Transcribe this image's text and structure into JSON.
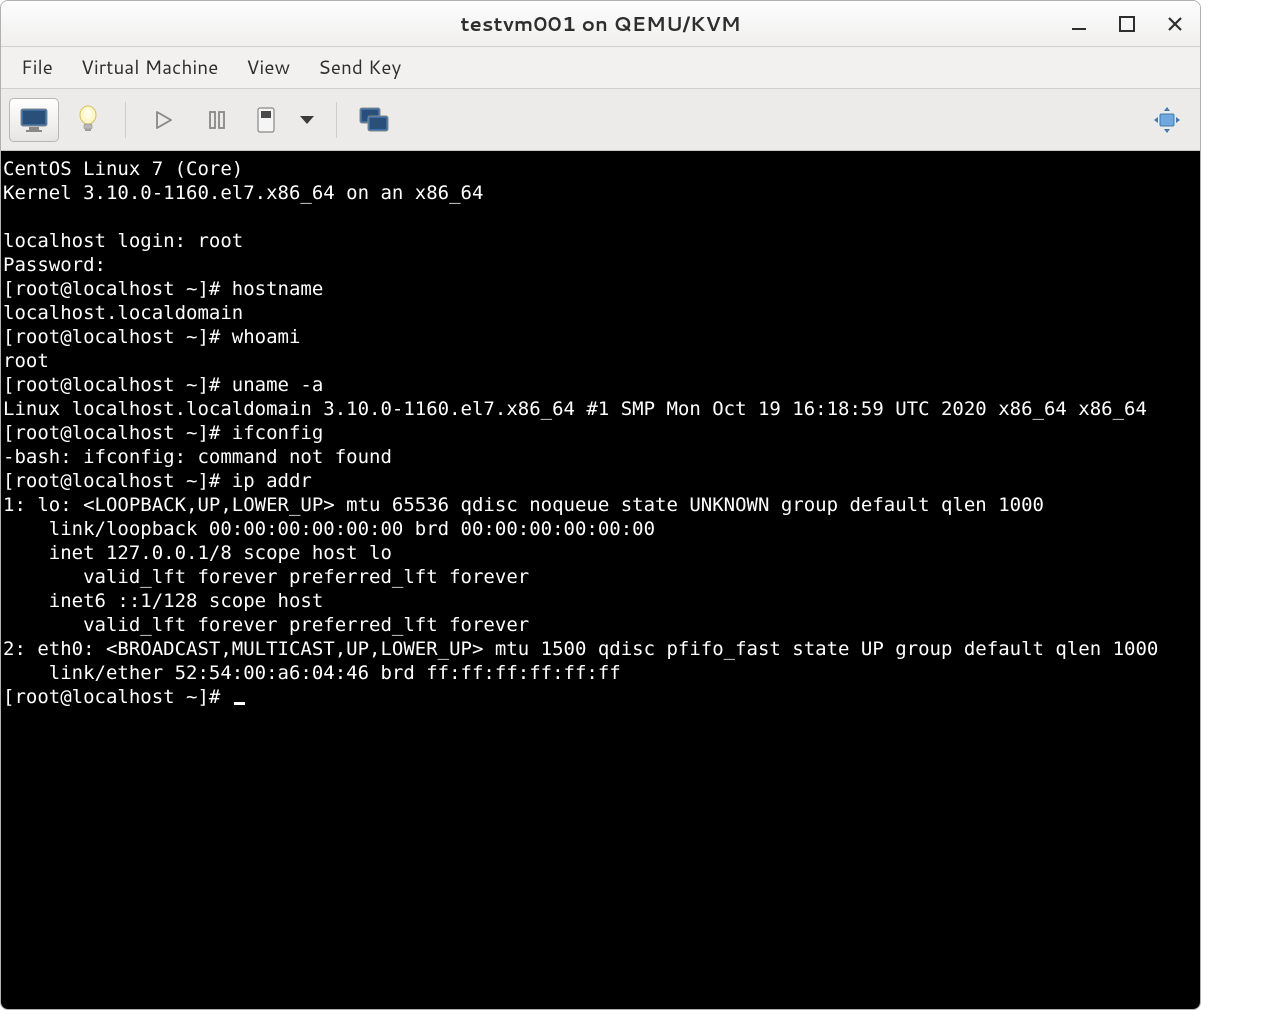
{
  "window": {
    "title": "testvm001 on QEMU/KVM"
  },
  "menu": {
    "file": "File",
    "vm": "Virtual Machine",
    "view": "View",
    "sendkey": "Send Key"
  },
  "toolbar": {
    "console_icon": "monitor-icon",
    "info_icon": "lightbulb-icon",
    "play_icon": "play-icon",
    "pause_icon": "pause-icon",
    "shutdown_icon": "shutdown-icon",
    "shutdown_menu_icon": "chevron-down-icon",
    "snapshots_icon": "snapshots-icon",
    "fullscreen_icon": "fullscreen-icon"
  },
  "terminal": {
    "lines": [
      "CentOS Linux 7 (Core)",
      "Kernel 3.10.0-1160.el7.x86_64 on an x86_64",
      "",
      "localhost login: root",
      "Password:",
      "[root@localhost ~]# hostname",
      "localhost.localdomain",
      "[root@localhost ~]# whoami",
      "root",
      "[root@localhost ~]# uname -a",
      "Linux localhost.localdomain 3.10.0-1160.el7.x86_64 #1 SMP Mon Oct 19 16:18:59 UTC 2020 x86_64 x86_64",
      "[root@localhost ~]# ifconfig",
      "-bash: ifconfig: command not found",
      "[root@localhost ~]# ip addr",
      "1: lo: <LOOPBACK,UP,LOWER_UP> mtu 65536 qdisc noqueue state UNKNOWN group default qlen 1000",
      "    link/loopback 00:00:00:00:00:00 brd 00:00:00:00:00:00",
      "    inet 127.0.0.1/8 scope host lo",
      "       valid_lft forever preferred_lft forever",
      "    inet6 ::1/128 scope host",
      "       valid_lft forever preferred_lft forever",
      "2: eth0: <BROADCAST,MULTICAST,UP,LOWER_UP> mtu 1500 qdisc pfifo_fast state UP group default qlen 1000",
      "    link/ether 52:54:00:a6:04:46 brd ff:ff:ff:ff:ff:ff",
      "[root@localhost ~]# "
    ]
  }
}
